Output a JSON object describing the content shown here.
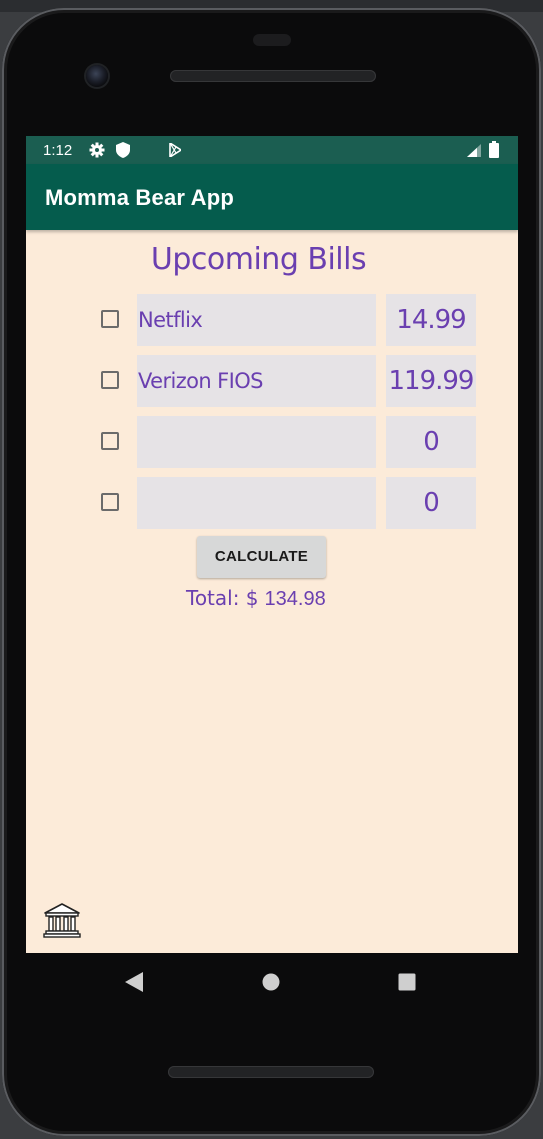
{
  "status_bar": {
    "time": "1:12",
    "icons": [
      "settings-gear-icon",
      "shield-icon",
      "play-store-icon",
      "signal-icon",
      "battery-icon"
    ]
  },
  "app_bar": {
    "title": "Momma Bear App"
  },
  "heading": "Upcoming Bills",
  "bills": [
    {
      "checked": false,
      "name": "Netflix",
      "amount": "14.99"
    },
    {
      "checked": false,
      "name": "Verizon FIOS",
      "amount": "119.99"
    },
    {
      "checked": false,
      "name": "",
      "amount": "0"
    },
    {
      "checked": false,
      "name": "",
      "amount": "0"
    }
  ],
  "calculate_button": {
    "label": "CALCULATE"
  },
  "total": {
    "label": "Total: $",
    "value": "134.98"
  },
  "bottom_icon": "bank-icon",
  "nav_bar": [
    "back-icon",
    "home-icon",
    "recents-icon"
  ],
  "colors": {
    "status_bar": "#1b5e51",
    "app_bar": "#055c4d",
    "background": "#fcebd9",
    "accent_text": "#6a3fb0",
    "field_bg": "#e6e3e6"
  }
}
